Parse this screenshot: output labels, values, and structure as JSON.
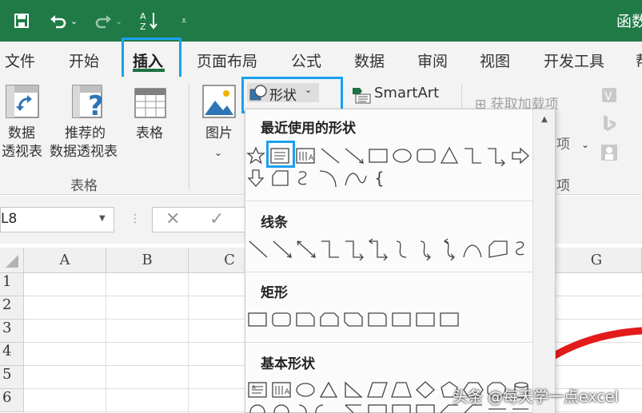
{
  "window": {
    "title": "函数"
  },
  "quick_access": {
    "save": "save-icon",
    "undo": "undo-icon",
    "redo": "redo-icon",
    "sort": "sort-az-icon",
    "customize": "customize-icon"
  },
  "tabs": [
    {
      "label": "文件"
    },
    {
      "label": "开始"
    },
    {
      "label": "插入"
    },
    {
      "label": "页面布局"
    },
    {
      "label": "公式"
    },
    {
      "label": "数据"
    },
    {
      "label": "审阅"
    },
    {
      "label": "视图"
    },
    {
      "label": "开发工具"
    },
    {
      "label": "帮"
    }
  ],
  "ribbon": {
    "pivot_line1": "数据",
    "pivot_line2": "透视表",
    "recommended_line1": "推荐的",
    "recommended_line2": "数据透视表",
    "table": "表格",
    "tables_group": "表格",
    "pictures": "图片",
    "shapes_button": "形状",
    "smartart": "SmartArt",
    "addins_get": "获取加载项",
    "addins_partial": "项",
    "addins_group_partial": "项"
  },
  "formula_bar": {
    "name_box": "L8",
    "cancel": "✕",
    "enter": "✓"
  },
  "columns": [
    "A",
    "B",
    "C",
    "G"
  ],
  "rows": [
    "1",
    "2",
    "3",
    "4",
    "5",
    "6"
  ],
  "shapes_menu": {
    "recent": "最近使用的形状",
    "lines": "线条",
    "rectangles": "矩形",
    "basic": "基本形状"
  },
  "watermark": "头条 @每天学一点excel",
  "colors": {
    "accent": "#1f7a46",
    "highlight": "#1aa1f0",
    "red_shape": "#e31b1b"
  }
}
